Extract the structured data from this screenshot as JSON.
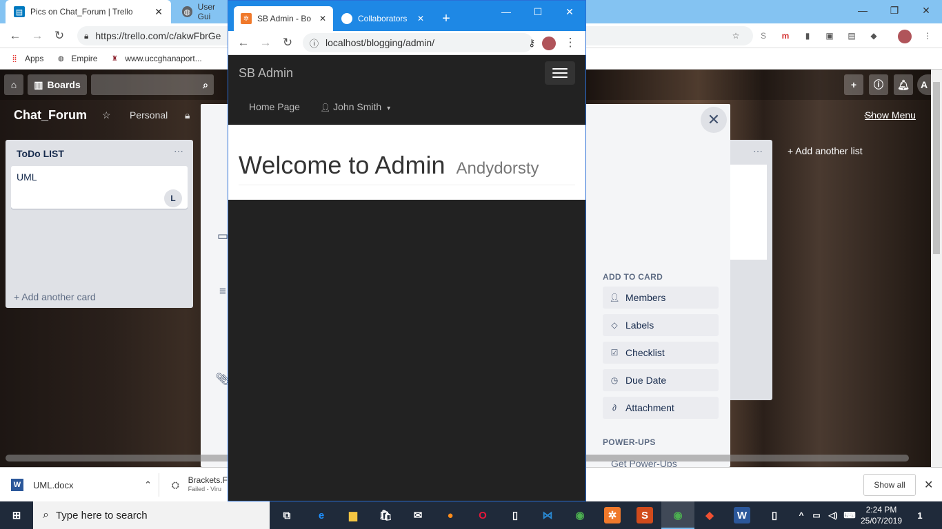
{
  "background_browser": {
    "tabs": [
      {
        "title": "Pics on Chat_Forum | Trello"
      },
      {
        "title": "User Gui"
      }
    ],
    "url": "https://trello.com/c/akwFbrGe",
    "bookmarks": [
      {
        "label": "Apps"
      },
      {
        "label": "Empire"
      },
      {
        "label": "www.uccghanaport..."
      }
    ]
  },
  "trello": {
    "header": {
      "boards_label": "Boards"
    },
    "board": {
      "title": "Chat_Forum",
      "visibility": "Personal",
      "show_menu": "Show Menu",
      "add_another_list": "Add another list"
    },
    "list": {
      "title": "ToDo LIST",
      "menu": "...",
      "card": {
        "label": "UML",
        "member_initial": "L"
      },
      "add_card": "Add another card"
    },
    "modal": {
      "add_to_card_title": "ADD TO CARD",
      "buttons": [
        {
          "label": "Members",
          "icon": "person-icon"
        },
        {
          "label": "Labels",
          "icon": "tag-icon"
        },
        {
          "label": "Checklist",
          "icon": "checkbox-icon"
        },
        {
          "label": "Due Date",
          "icon": "clock-icon"
        },
        {
          "label": "Attachment",
          "icon": "paperclip-icon"
        }
      ],
      "powerups_title": "POWER-UPS",
      "get_powerups": "Get Power-Ups"
    }
  },
  "popup_browser": {
    "tabs": [
      {
        "title": "SB Admin - Bo"
      },
      {
        "title": "Collaborators"
      }
    ],
    "url": "localhost/blogging/admin/",
    "page": {
      "brand": "SB Admin",
      "nav": {
        "home": "Home Page",
        "user": "John Smith"
      },
      "heading": "Welcome to Admin",
      "subheading": "Andydorsty"
    }
  },
  "downloads": {
    "items": [
      {
        "name": "UML.docx",
        "status": ""
      },
      {
        "name": "Brackets.F",
        "status": "Failed - Viru"
      }
    ],
    "show_all": "Show all"
  },
  "taskbar": {
    "search_placeholder": "Type here to search",
    "time": "2:24 PM",
    "date": "25/07/2019",
    "notification_count": "1"
  },
  "colors": {
    "chrome_blue": "#1e88e5",
    "bootstrap_dark_nav": "#222222",
    "trello_list_bg": "#dfe1e6",
    "taskbar": "#1f2a3a"
  }
}
